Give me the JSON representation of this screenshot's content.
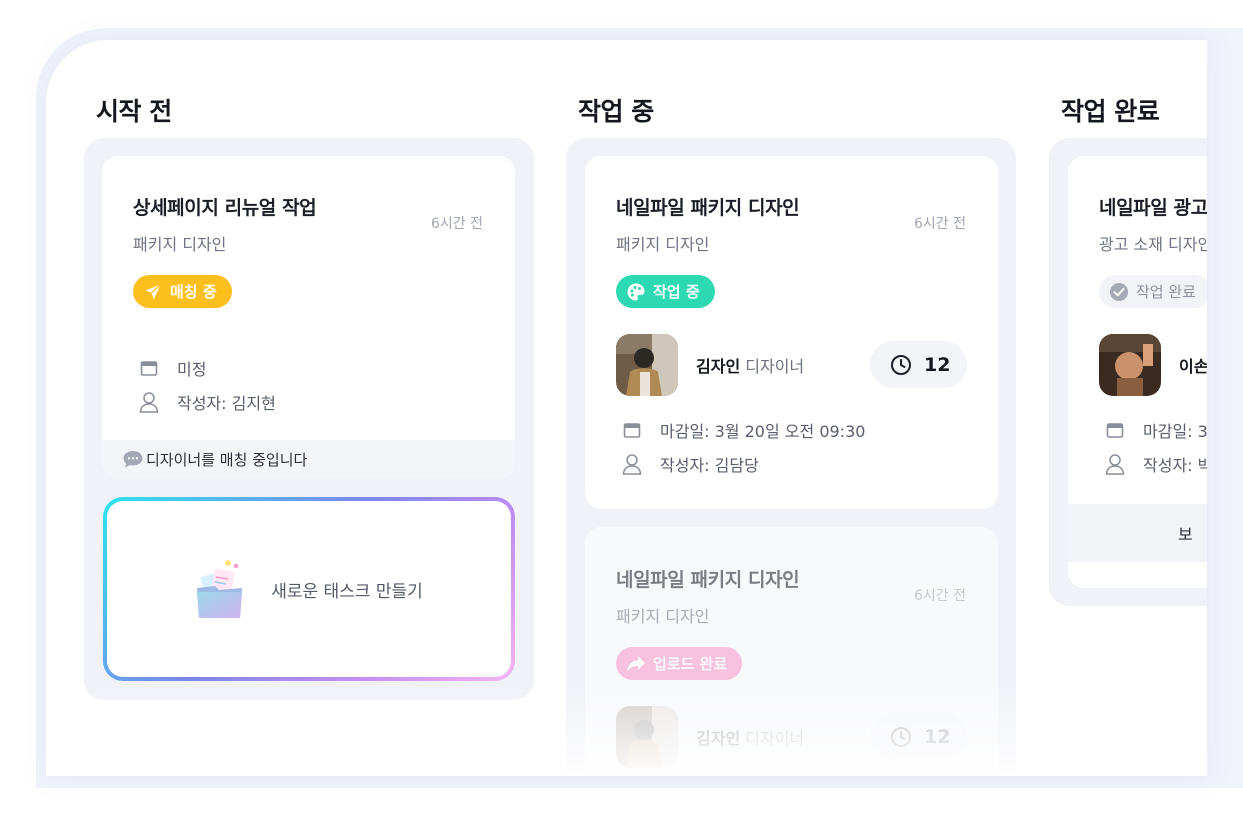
{
  "columns": [
    {
      "title": "시작 전"
    },
    {
      "title": "작업 중"
    },
    {
      "title": "작업 완료"
    }
  ],
  "todo_card": {
    "title": "상세페이지 리뉴얼 작업",
    "subtitle": "패키지 디자인",
    "time": "6시간 전",
    "badge": "매칭 중",
    "date": "미정",
    "author": "작성자: 김지현",
    "footer": "디자이너를 매칭 중입니다"
  },
  "new_task": {
    "label": "새로운 태스크 만들기"
  },
  "progress_card_1": {
    "title": "네일파일 패키지 디자인",
    "subtitle": "패키지 디자인",
    "time": "6시간 전",
    "badge": "작업 중",
    "designer_name": "김자인",
    "designer_role": "디자이너",
    "timer": "12",
    "deadline": "마감일: 3월 20일 오전 09:30",
    "author": "작성자: 김담당"
  },
  "progress_card_2": {
    "title": "네일파일 패키지 디자인",
    "subtitle": "패키지 디자인",
    "time": "6시간 전",
    "badge": "업로드 완료",
    "designer_name": "김자인",
    "designer_role": "디자이너",
    "timer": "12"
  },
  "done_card": {
    "title": "네일파일 광고",
    "subtitle": "광고 소재 디자인",
    "badge": "작업 완료",
    "designer_name": "이손",
    "deadline": "마감일: 3",
    "author": "작성자: 박",
    "footer_button": "보"
  },
  "colors": {
    "matching": "#fdbf1e",
    "working": "#2dd9b2",
    "uploaded": "#ff9ccd",
    "done_badge_bg": "#f2f3f6"
  },
  "icons": [
    "paper-plane-icon",
    "palette-icon",
    "share-arrow-icon",
    "check-circle-icon",
    "calendar-icon",
    "user-icon",
    "chat-bubble-icon",
    "clock-icon",
    "folder-illustration-icon"
  ]
}
